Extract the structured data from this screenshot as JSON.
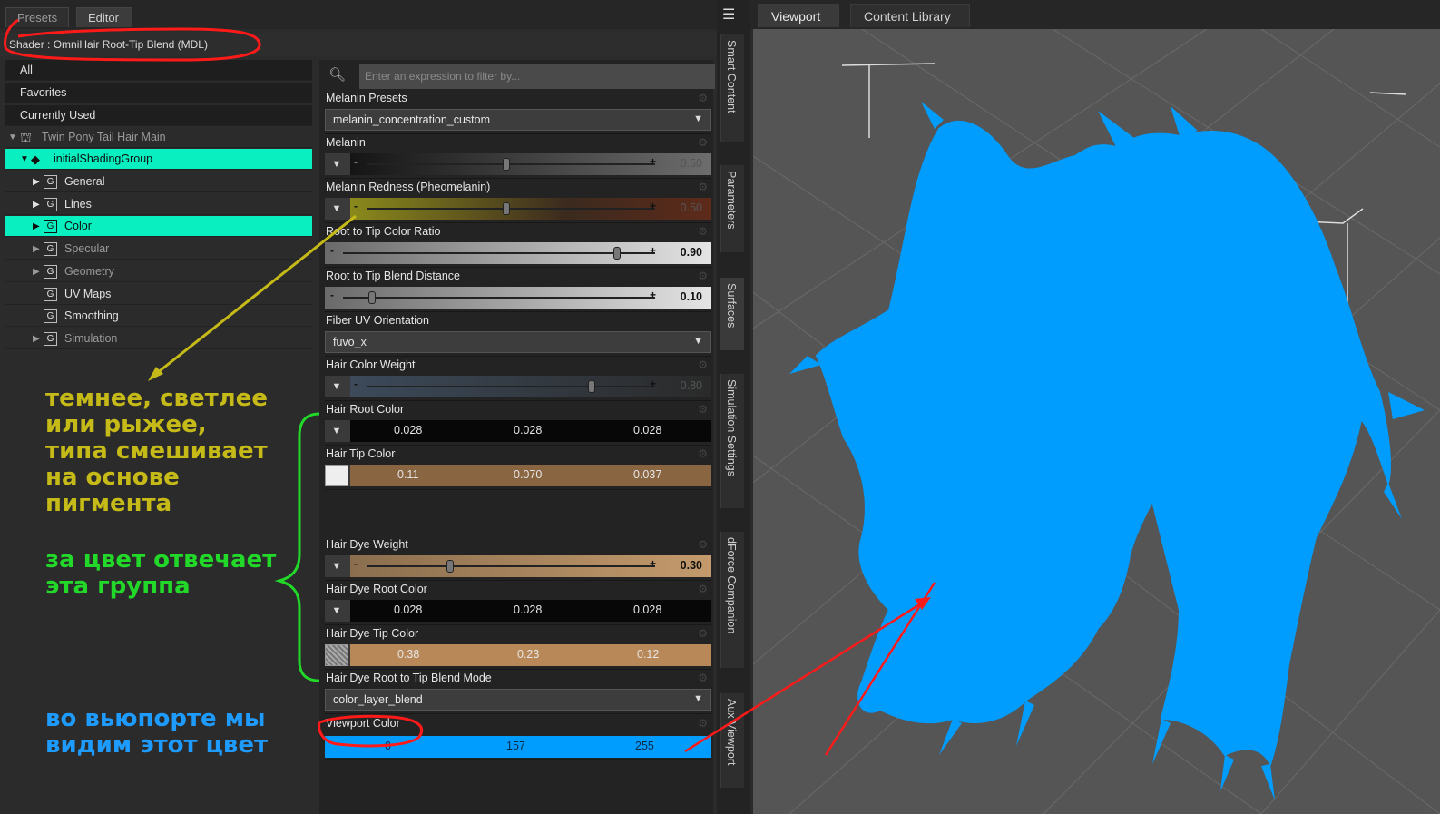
{
  "tabs": {
    "presets": "Presets",
    "editor": "Editor"
  },
  "shader": "Shader :  OmniHair Root-Tip Blend (MDL)",
  "tree": {
    "all": "All",
    "favorites": "Favorites",
    "currently_used": "Currently Used",
    "figure": "Twin Pony Tail Hair Main",
    "group": "initialShadingGroup",
    "items": [
      {
        "label": "General",
        "expandable": true,
        "dim": false,
        "selected": false
      },
      {
        "label": "Lines",
        "expandable": true,
        "dim": false,
        "selected": false
      },
      {
        "label": "Color",
        "expandable": true,
        "dim": false,
        "selected": true
      },
      {
        "label": "Specular",
        "expandable": true,
        "dim": true,
        "selected": false
      },
      {
        "label": "Geometry",
        "expandable": true,
        "dim": true,
        "selected": false
      },
      {
        "label": "UV Maps",
        "expandable": false,
        "dim": false,
        "selected": false
      },
      {
        "label": "Smoothing",
        "expandable": false,
        "dim": false,
        "selected": false
      },
      {
        "label": "Simulation",
        "expandable": true,
        "dim": true,
        "selected": false
      }
    ],
    "group_icon_letter": "G"
  },
  "filter_placeholder": "Enter an expression to filter by...",
  "params": {
    "melanin_presets": {
      "label": "Melanin Presets",
      "value": "melanin_concentration_custom"
    },
    "melanin": {
      "label": "Melanin",
      "value": "0.50"
    },
    "melanin_redness": {
      "label": "Melanin Redness (Pheomelanin)",
      "value": "0.50"
    },
    "root_tip_ratio": {
      "label": "Root to Tip Color Ratio",
      "value": "0.90"
    },
    "root_tip_distance": {
      "label": "Root to Tip Blend Distance",
      "value": "0.10"
    },
    "fiber_uv": {
      "label": "Fiber UV Orientation",
      "value": "fuvo_x"
    },
    "hair_color_weight": {
      "label": "Hair Color Weight",
      "value": "0.80"
    },
    "hair_root_color": {
      "label": "Hair Root Color",
      "r": "0.028",
      "g": "0.028",
      "b": "0.028"
    },
    "hair_tip_color": {
      "label": "Hair Tip Color",
      "r": "0.11",
      "g": "0.070",
      "b": "0.037"
    },
    "hair_dye_weight": {
      "label": "Hair Dye Weight",
      "value": "0.30"
    },
    "hair_dye_root_color": {
      "label": "Hair Dye Root Color",
      "r": "0.028",
      "g": "0.028",
      "b": "0.028"
    },
    "hair_dye_tip_color": {
      "label": "Hair Dye Tip Color",
      "r": "0.38",
      "g": "0.23",
      "b": "0.12"
    },
    "blend_mode": {
      "label": "Hair Dye Root to Tip Blend Mode",
      "value": "color_layer_blend"
    },
    "viewport_color": {
      "label": "Viewport Color",
      "r": "0",
      "g": "157",
      "b": "255"
    }
  },
  "notes": {
    "yellow": "темнее, светлее\nили рыжее,\nтипа смешивает\nна основе\nпигмента",
    "green": "за цвет отвечает\nэта группа",
    "blue": "во вьюпорте мы\nвидим этот цвет"
  },
  "dock_tabs": [
    "Smart Content",
    "Parameters",
    "Surfaces",
    "Simulation Settings",
    "dForce Companion",
    "Aux Viewport"
  ],
  "viewport_tabs": {
    "viewport": "Viewport",
    "content_library": "Content Library"
  },
  "colors": {
    "selection": "#0aefc0",
    "hair_viewport": "#009dff",
    "annotation_red": "#ff1a1a",
    "annotation_yellow": "#c6ba18",
    "annotation_green": "#22d829",
    "annotation_blue": "#1e9bff",
    "hair_tip_swatch": "#8a6542",
    "hair_dye_tip_swatch": "#b88858"
  }
}
